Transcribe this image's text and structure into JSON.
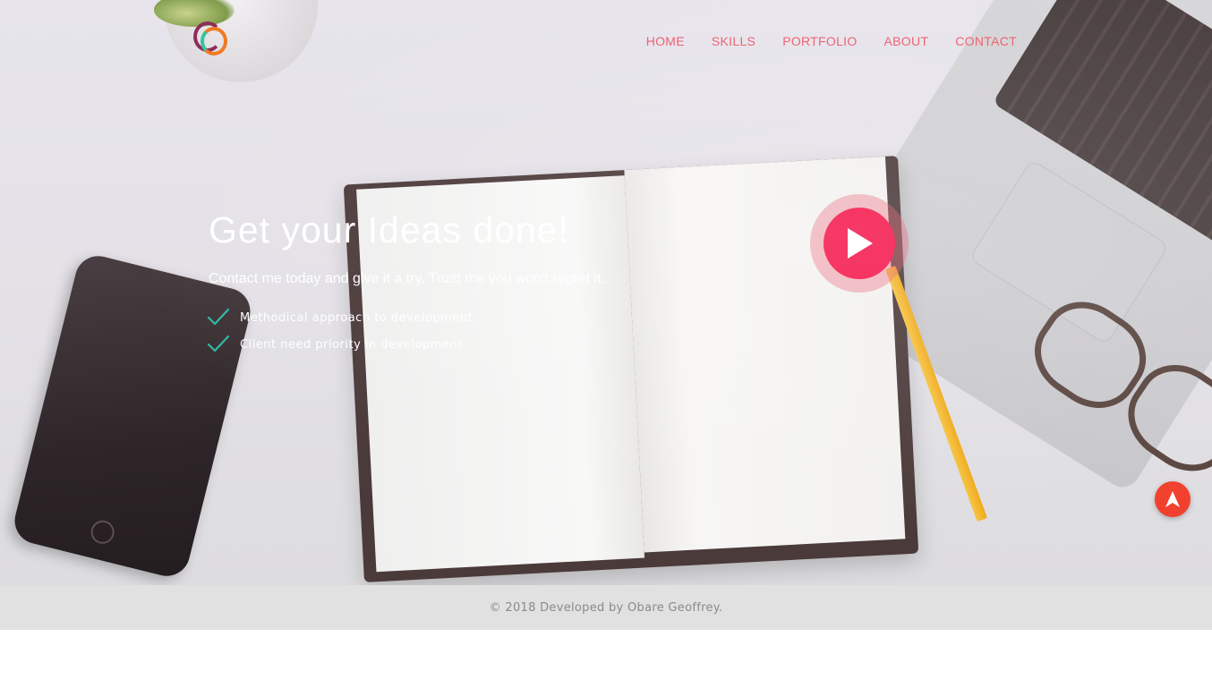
{
  "nav": {
    "items": [
      {
        "label": "HOME"
      },
      {
        "label": "SKILLS"
      },
      {
        "label": "PORTFOLIO"
      },
      {
        "label": "ABOUT"
      },
      {
        "label": "CONTACT"
      }
    ]
  },
  "hero": {
    "headline": "Get your Ideas done!",
    "subline": "Contact me today and give it a try. Trust me you won't regret it.",
    "features": [
      {
        "text": "Methodical approach to development."
      },
      {
        "text": "Client need priority in development."
      }
    ]
  },
  "footer": {
    "copyright": "© 2018 Developed by Obare Geoffrey."
  },
  "icons": {
    "logo": "logo-icon",
    "play": "play-icon",
    "check": "check-icon",
    "scroll_top": "arrow-up-icon"
  },
  "colors": {
    "nav_link": "#ec5c6c",
    "play_button": "#f5174c",
    "check": "#2fb8a3",
    "scroll_top": "#f1412e",
    "footer_bg": "#e2e1e2"
  }
}
